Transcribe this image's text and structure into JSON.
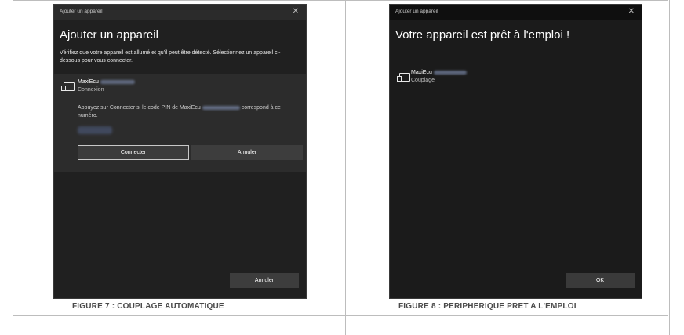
{
  "figure7": {
    "window_title": "Ajouter un appareil",
    "close_glyph": "✕",
    "heading": "Ajouter un appareil",
    "description": "Vérifiez que votre appareil est allumé et qu'il peut être détecté. Sélectionnez un appareil ci-dessous pour vous connecter.",
    "device_name": "MaxiEcu",
    "device_status": "Connexion",
    "pin_message_start": "Appuyez sur Connecter si le code PIN de MaxiEcu",
    "pin_message_end": "correspond à ce numéro.",
    "connect_label": "Connecter",
    "cancel_label": "Annuler",
    "footer_cancel_label": "Annuler",
    "caption": "FIGURE 7 : COUPLAGE AUTOMATIQUE"
  },
  "figure8": {
    "window_title": "Ajouter un appareil",
    "close_glyph": "✕",
    "heading": "Votre appareil est prêt à l'emploi !",
    "device_name": "MaxiEcu",
    "device_status": "Couplage",
    "ok_label": "OK",
    "caption": "FIGURE 8 : PERIPHERIQUE PRET A L'EMPLOI"
  },
  "icons": {
    "device": "device-icon",
    "close": "close-icon"
  },
  "colors": {
    "window_bg": "#202020",
    "panel_bg": "#2c2c2c",
    "caption_text": "#4a4a4a"
  }
}
